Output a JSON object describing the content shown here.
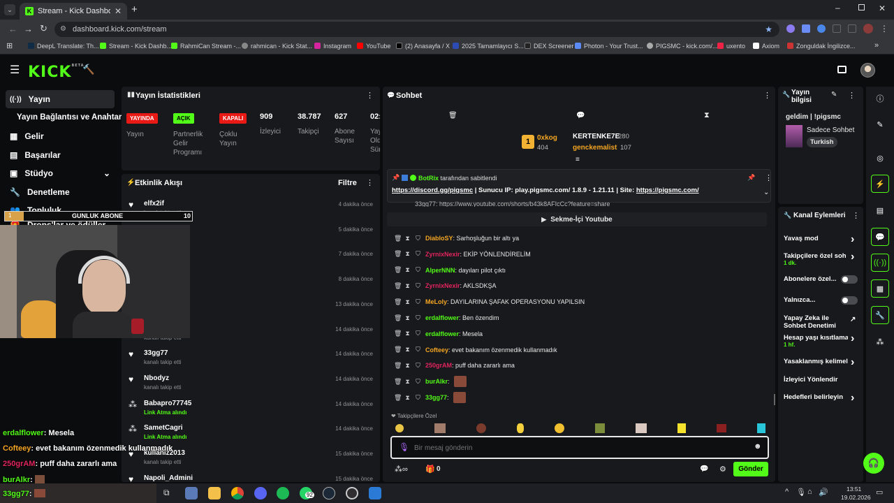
{
  "browser": {
    "tab_title": "Stream - Kick Dashboard",
    "url": "dashboard.kick.com/stream",
    "bookmarks": [
      "DeepL Translate: Th...",
      "Stream - Kick Dashb...",
      "RahmiCan Stream -...",
      "rahmican - Kick Stat...",
      "Instagram",
      "YouTube",
      "(2) Anasayfa / X",
      "2025 Tamamlayıcı S...",
      "DEX Screener",
      "Photon - Your Trust...",
      "PIGSMC - kick.com/...",
      "uxento",
      "Axiom",
      "Zonguldak İngilizce..."
    ]
  },
  "header": {
    "logo": "KICK",
    "logo_sup": "BETA"
  },
  "nav": {
    "items": [
      "Yayın",
      "Yayın Bağlantısı ve Anahtarı",
      "Gelir",
      "Başarılar",
      "Stüdyo",
      "Denetleme",
      "Topluluk",
      "Drops'lar ve ödüller"
    ]
  },
  "overlay": {
    "sub_goal_label": "GUNLUK ABONE",
    "sub_goal_value": "10",
    "sub_goal_start": "1",
    "chat": [
      {
        "user": "erdalflower",
        "text": ": Mesela"
      },
      {
        "user": "Cofteey",
        "text": ": evet bakanım özenmedik kullanmadık"
      },
      {
        "user": "250grAM",
        "text": ": puff daha zararlı ama"
      },
      {
        "user": "burAlkr",
        "text": ":"
      },
      {
        "user": "33gg77",
        "text": ":"
      }
    ]
  },
  "stats": {
    "title": "Yayın İstatistikleri",
    "items": [
      {
        "badge": "YAYINDA",
        "label": "Yayın"
      },
      {
        "badge": "AÇIK",
        "label": "Partnerlik Gelir Programı"
      },
      {
        "badge": "KAPALI",
        "label": "Çoklu Yayın"
      },
      {
        "value": "909",
        "label": "İzleyici"
      },
      {
        "value": "38.787",
        "label": "Takipçi"
      },
      {
        "value": "627",
        "label": "Abone Sayısı"
      },
      {
        "value": "02:",
        "label": "Yay Old Sür"
      }
    ]
  },
  "feed": {
    "title": "Etkinlik Akışı",
    "filter": "Filtre",
    "events": [
      {
        "name": "elfx2if",
        "sub": "kanalı takip etti",
        "time": "4 dakika önce",
        "icon": "heart"
      },
      {
        "name": "jahsonwilly",
        "sub": "kanalı takip etti",
        "time": "5 dakika önce",
        "icon": "heart"
      },
      {
        "name": "",
        "sub": "",
        "time": "7 dakika önce",
        "icon": "heart"
      },
      {
        "name": "",
        "sub": "",
        "time": "8 dakika önce",
        "icon": "heart"
      },
      {
        "name": "",
        "sub": "",
        "time": "13 dakika önce",
        "icon": "heart"
      },
      {
        "name": "",
        "sub": "kanalı takip etti",
        "time": "14 dakika önce",
        "icon": "heart"
      },
      {
        "name": "33gg77",
        "sub": "kanalı takip etti",
        "time": "14 dakika önce",
        "icon": "heart"
      },
      {
        "name": "Nbodyz",
        "sub": "kanalı takip etti",
        "time": "14 dakika önce",
        "icon": "heart"
      },
      {
        "name": "Babapro77745",
        "sub": "Link Atma alındı",
        "time": "14 dakika önce",
        "icon": "reward"
      },
      {
        "name": "SametCagri",
        "sub": "Link Atma alındı",
        "time": "14 dakika önce",
        "icon": "reward"
      },
      {
        "name": "kullaniz2013",
        "sub": "kanalı takip etti",
        "time": "15 dakika önce",
        "icon": "heart"
      },
      {
        "name": "Napoli_Admini",
        "sub": "",
        "time": "15 dakika önce",
        "icon": "heart"
      }
    ]
  },
  "chat": {
    "title": "Sohbet",
    "leaderboard": [
      {
        "rank": "1",
        "name": "0xkog",
        "value": "404"
      },
      {
        "name": "KERTENKE7E",
        "value": "280"
      },
      {
        "name": "genckemalist",
        "value": "107"
      }
    ],
    "pinned": {
      "by_user": "BotRix",
      "by_suffix": " tarafından sabitlendi",
      "link1": "https://discord.gg/pigsmc",
      "middle": " | Sunucu IP: play.pigsmc.com/ 1.8.9 - 1.21.11 | Site: ",
      "link2": "https://pigsmc.com/"
    },
    "partial_link": "33gg77: https://www.youtube.com/shorts/b43k8AFIcCc?feature=share",
    "youtube_button": "Sekme-İçi Youtube",
    "messages": [
      {
        "user": "DiabloSY",
        "color": "#f5a623",
        "text": ": Sarhoşluğun bir altı ya"
      },
      {
        "user": "ZyrnixNexir",
        "color": "#e0245e",
        "text": ": EKİP YÖNLENDİRELİM"
      },
      {
        "user": "AlperNNN",
        "color": "#53fc18",
        "text": ": dayıları pilot çıktı"
      },
      {
        "user": "ZyrnixNexir",
        "color": "#e0245e",
        "text": ": AKLSDKŞA"
      },
      {
        "user": "MeLoly",
        "color": "#f5a623",
        "text": ": DAYILARINA ŞAFAK OPERASYONU YAPILSIN"
      },
      {
        "user": "erdalflower",
        "color": "#53fc18",
        "text": ": Ben özendim"
      },
      {
        "user": "erdalflower",
        "color": "#53fc18",
        "text": ": Mesela"
      },
      {
        "user": "Cofteey",
        "color": "#f5a623",
        "text": ": evet bakanım özenmedik kullanmadık"
      },
      {
        "user": "250grAM",
        "color": "#e0245e",
        "text": ": puff daha zararlı ama"
      },
      {
        "user": "burAlkr",
        "color": "#53fc18",
        "text": ":"
      },
      {
        "user": "33gg77",
        "color": "#53fc18",
        "text": ":"
      }
    ],
    "emote_section": "Takipçilere Özel",
    "input_placeholder": "Bir mesaj gönderin",
    "points": "0",
    "send": "Gönder"
  },
  "stream_info": {
    "title": "Yayın bilgisi",
    "stream_title": "geldim | !pigsmc",
    "category": "Sadece Sohbet",
    "language": "Turkish"
  },
  "channel_actions": {
    "title": "Kanal Eylemleri",
    "items": [
      {
        "label": "Yavaş mod",
        "sub": "",
        "kind": "arrow"
      },
      {
        "label": "Takipçilere özel soh",
        "sub": "1 dk.",
        "kind": "arrow"
      },
      {
        "label": "Abonelere özel...",
        "sub": "",
        "kind": "toggle"
      },
      {
        "label": "Yalnızca...",
        "sub": "",
        "kind": "toggle"
      },
      {
        "label": "Yapay Zeka ile Sohbet Denetimi",
        "sub": "",
        "kind": "external"
      },
      {
        "label": "Hesap yaşı kısıtlama",
        "sub": "1 hf.",
        "kind": "arrow"
      },
      {
        "label": "Yasaklanmış kelimel",
        "sub": "",
        "kind": "arrow"
      },
      {
        "label": "İzleyici Yönlendir",
        "sub": "",
        "kind": "none"
      },
      {
        "label": "Hedefleri belirleyin",
        "sub": "",
        "kind": "arrow"
      }
    ]
  },
  "taskbar": {
    "time": "13:51",
    "date": "19.02.2026",
    "whatsapp_badge": "92"
  },
  "colors": {
    "kick_green": "#53fc18",
    "panel": "#18191c",
    "bg": "#0b0c0e"
  }
}
